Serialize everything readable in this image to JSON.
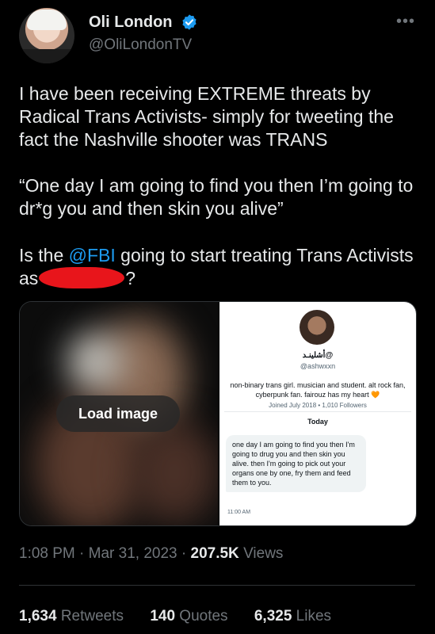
{
  "author": {
    "name": "Oli London",
    "handle": "@OliLondonTV",
    "verified_icon": "verified-badge-icon",
    "more_label": "•••"
  },
  "tweet": {
    "paragraph1": "I have been receiving EXTREME threats by Radical Trans Activists- simply for tweeting the fact the Nashville shooter was TRANS",
    "paragraph2": "“One day I am going to find you then I’m going to dr*g you and then skin you alive”",
    "paragraph3_before": "Is the ",
    "paragraph3_mention": "@FBI",
    "paragraph3_middle": " going to start treating Trans Activists as",
    "paragraph3_after": "?"
  },
  "media": {
    "load_label": "Load image",
    "screenshot": {
      "profile_name": "أشلينـد@",
      "profile_handle": "@ashwxxn",
      "bio": "non-binary trans girl. musician and student. alt rock fan, cyberpunk fan. fairouz has my heart",
      "heart": "🧡",
      "joined": "Joined July 2018 • 1,010 Followers",
      "day_label": "Today",
      "message": "one day I am going to find you then I'm going to drug you and then skin you alive. then I'm going to pick out your organs one by one, fry them and feed them to you.",
      "time": "11:00 AM"
    }
  },
  "meta": {
    "time": "1:08 PM",
    "sep": " · ",
    "date": "Mar 31, 2023",
    "views_num": "207.5K",
    "views_label": " Views"
  },
  "stats": {
    "retweets_num": "1,634",
    "retweets_label": "Retweets",
    "quotes_num": "140",
    "quotes_label": "Quotes",
    "likes_num": "6,325",
    "likes_label": "Likes"
  },
  "colors": {
    "background": "#000000",
    "text": "#e7e9ea",
    "muted": "#71767b",
    "accent": "#1d9bf0",
    "redaction": "#e8151b"
  }
}
